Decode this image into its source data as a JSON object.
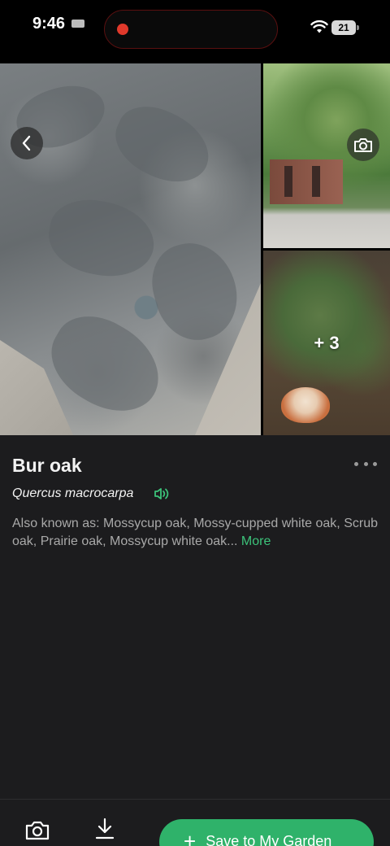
{
  "status_bar": {
    "time": "9:46",
    "battery": "21"
  },
  "gallery": {
    "extra_photos_label": "+ 3"
  },
  "plant": {
    "common_name": "Bur oak",
    "scientific_name": "Quercus macrocarpa",
    "also_known_as": "Also known as: Mossycup oak, Mossy-cupped white oak, Scrub oak, Prairie oak, Mossycup white oak...",
    "more_label": "More"
  },
  "actions": {
    "save_label": "Save to My Garden"
  },
  "colors": {
    "accent": "#2fb26a",
    "link": "#3cc37a",
    "background": "#1c1c1e",
    "recording": "#e0392b"
  }
}
